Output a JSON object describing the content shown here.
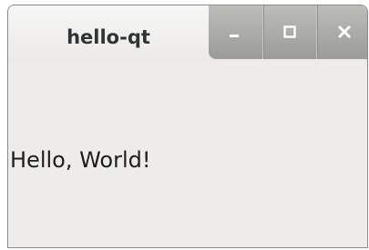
{
  "window": {
    "title": "hello-qt",
    "controls": {
      "minimize_icon": "minimize-icon",
      "maximize_icon": "maximize-icon",
      "close_icon": "close-icon"
    }
  },
  "content": {
    "label": "Hello, World!"
  }
}
